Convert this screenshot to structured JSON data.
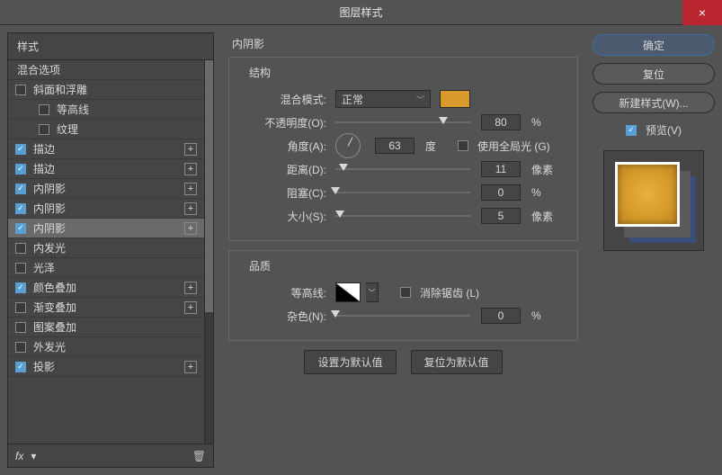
{
  "title": "图层样式",
  "styles": {
    "header": "样式",
    "blend": "混合选项",
    "items": [
      {
        "label": "斜面和浮雕",
        "checked": false,
        "plus": false,
        "sub": false
      },
      {
        "label": "等高线",
        "checked": false,
        "plus": false,
        "sub": true
      },
      {
        "label": "纹理",
        "checked": false,
        "plus": false,
        "sub": true
      },
      {
        "label": "描边",
        "checked": true,
        "plus": true,
        "sub": false
      },
      {
        "label": "描边",
        "checked": true,
        "plus": true,
        "sub": false
      },
      {
        "label": "内阴影",
        "checked": true,
        "plus": true,
        "sub": false
      },
      {
        "label": "内阴影",
        "checked": true,
        "plus": true,
        "sub": false
      },
      {
        "label": "内阴影",
        "checked": true,
        "plus": true,
        "sub": false,
        "selected": true
      },
      {
        "label": "内发光",
        "checked": false,
        "plus": false,
        "sub": false
      },
      {
        "label": "光泽",
        "checked": false,
        "plus": false,
        "sub": false
      },
      {
        "label": "颜色叠加",
        "checked": true,
        "plus": true,
        "sub": false
      },
      {
        "label": "渐变叠加",
        "checked": false,
        "plus": true,
        "sub": false
      },
      {
        "label": "图案叠加",
        "checked": false,
        "plus": false,
        "sub": false
      },
      {
        "label": "外发光",
        "checked": false,
        "plus": false,
        "sub": false
      },
      {
        "label": "投影",
        "checked": true,
        "plus": true,
        "sub": false
      }
    ],
    "footer_fx": "fx"
  },
  "settings": {
    "heading": "内阴影",
    "structure": {
      "legend": "结构",
      "blend_mode_label": "混合模式:",
      "blend_mode_value": "正常",
      "opacity_label": "不透明度(O):",
      "opacity_value": "80",
      "opacity_unit": "%",
      "angle_label": "角度(A):",
      "angle_value": "63",
      "angle_unit": "度",
      "global_light": "使用全局光 (G)",
      "distance_label": "距离(D):",
      "distance_value": "11",
      "distance_unit": "像素",
      "choke_label": "阻塞(C):",
      "choke_value": "0",
      "choke_unit": "%",
      "size_label": "大小(S):",
      "size_value": "5",
      "size_unit": "像素"
    },
    "quality": {
      "legend": "品质",
      "contour_label": "等高线:",
      "antialias": "消除锯齿 (L)",
      "noise_label": "杂色(N):",
      "noise_value": "0",
      "noise_unit": "%"
    },
    "reset_default": "设置为默认值",
    "revert_default": "复位为默认值"
  },
  "buttons": {
    "ok": "确定",
    "cancel": "复位",
    "new_style": "新建样式(W)...",
    "preview": "预览(V)"
  }
}
